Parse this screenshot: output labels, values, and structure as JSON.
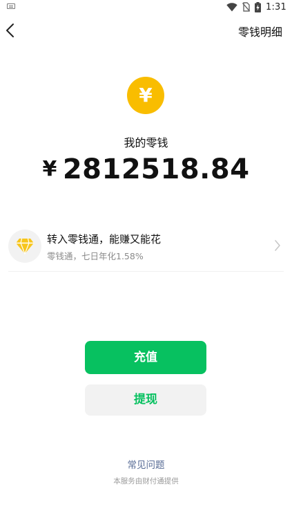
{
  "status_bar": {
    "time": "1:31",
    "icons": [
      "keyboard-icon",
      "wifi-icon",
      "no-sim-icon",
      "battery-charging-icon"
    ]
  },
  "nav": {
    "back_icon": "chevron-left-icon",
    "action": "零钱明细"
  },
  "balance": {
    "icon": "yuan-coin-icon",
    "icon_symbol": "¥",
    "icon_color": "#f9bd00",
    "label": "我的零钱",
    "currency": "¥",
    "amount": "2812518.84"
  },
  "promo": {
    "icon": "diamond-icon",
    "title": "转入零钱通，能赚又能花",
    "subtitle": "零钱通，七日年化1.58%",
    "chevron": "chevron-right-icon"
  },
  "actions": {
    "recharge": "充值",
    "withdraw": "提现"
  },
  "footer": {
    "faq": "常见问题",
    "service": "本服务由财付通提供"
  },
  "colors": {
    "brand_green": "#07c160",
    "link_blue": "#576b95",
    "coin_yellow": "#f9bd00"
  }
}
